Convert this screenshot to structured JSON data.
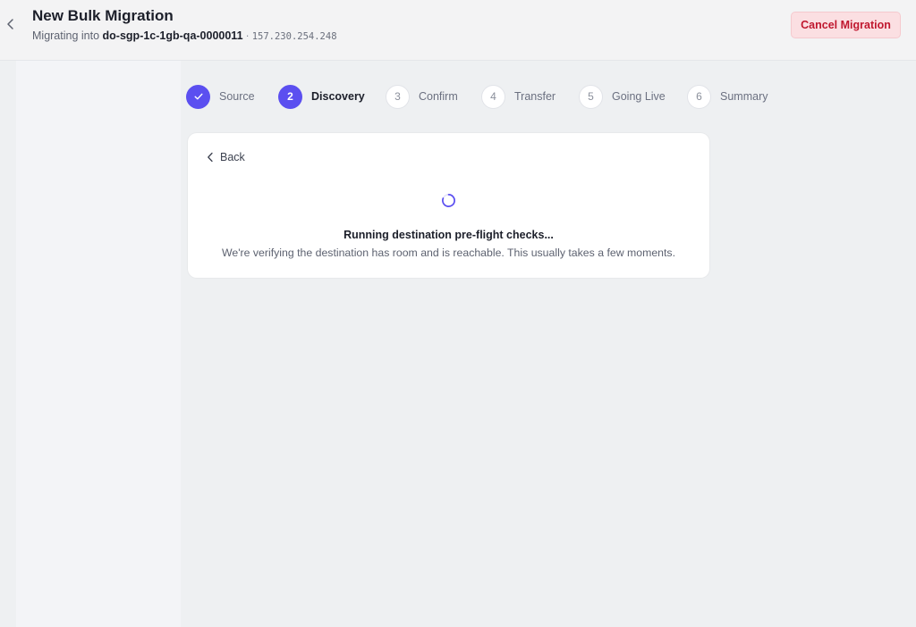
{
  "header": {
    "title": "New Bulk Migration",
    "subtitle_prefix": "Migrating into",
    "host": "do-sgp-1c-1gb-qa-0000011",
    "separator": "·",
    "ip": "157.230.254.248",
    "cancel_label": "Cancel Migration"
  },
  "stepper": {
    "steps": [
      {
        "number": "1",
        "label": "Source",
        "state": "done"
      },
      {
        "number": "2",
        "label": "Discovery",
        "state": "active"
      },
      {
        "number": "3",
        "label": "Confirm",
        "state": "pending"
      },
      {
        "number": "4",
        "label": "Transfer",
        "state": "pending"
      },
      {
        "number": "5",
        "label": "Going Live",
        "state": "pending"
      },
      {
        "number": "6",
        "label": "Summary",
        "state": "pending"
      }
    ]
  },
  "card": {
    "back_label": "Back",
    "status_title": "Running destination pre-flight checks...",
    "status_description": "We're verifying the destination has room and is reachable. This usually takes a few moments."
  },
  "colors": {
    "accent": "#5b4ff0",
    "danger": "#c0182f",
    "danger_bg": "#fbdfe2"
  }
}
